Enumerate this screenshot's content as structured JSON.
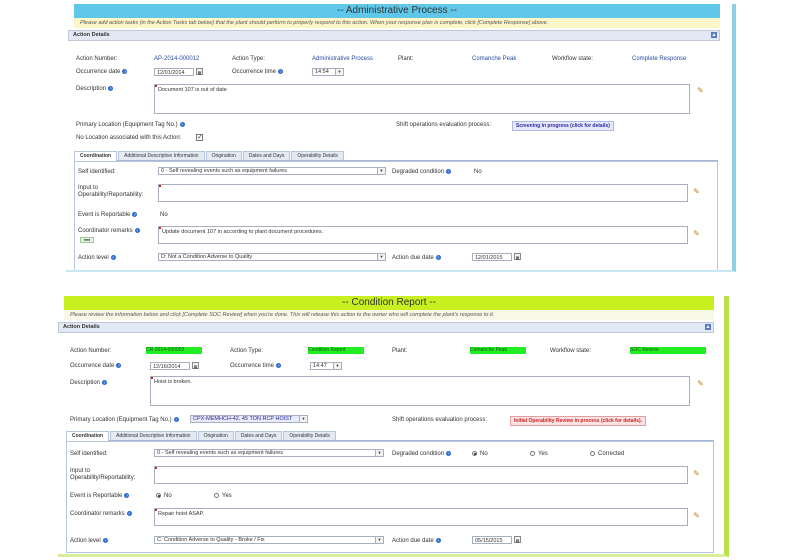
{
  "colors": {
    "panel1_title_bg": "#5fc8ea",
    "panel2_title_bg": "#c8ef20",
    "highlight_green": "#22ee22",
    "link_blue": "#2a4c9c",
    "error_red": "#d02020"
  },
  "icons": {
    "help": "help-icon",
    "calendar": "calendar-icon",
    "edit": "edit-pencil-icon",
    "dropdown": "chevron-down-icon",
    "collapse": "collapse-icon"
  },
  "admin": {
    "title": "-- Administrative Process --",
    "instruction": "Please add action tasks (in the Action Tasks tab below) that the plant should perform to properly respond to this action. When your response plan is complete, click [Complete Response] above.",
    "section": "Action Details",
    "action_number_label": "Action Number:",
    "action_number": "AP-2014-000012",
    "action_type_label": "Action Type:",
    "action_type": "Administrative Process",
    "plant_label": "Plant:",
    "plant": "Comanche Peak",
    "workflow_label": "Workflow state:",
    "workflow": "Complete Response",
    "occ_date_label": "Occurrence date",
    "occ_date": "12/01/2014",
    "occ_time_label": "Occurrence time",
    "occ_time": "14:54",
    "description_label": "Description",
    "description": "Document 107 is out of date",
    "primary_location_label": "Primary Location (Equipment Tag No.)",
    "shift_label": "Shift operations evaluation process:",
    "shift_status": "Screening in progress (click for details)",
    "no_location_label": "No Location associated with this Action:",
    "tabs": [
      "Coordination",
      "Additional Descriptive Information",
      "Origination",
      "Dates and Days",
      "Operability Details"
    ],
    "self_identified_label": "Self identified:",
    "self_identified": "0 - Self revealing events such as equipment failures",
    "degraded_label": "Degraded condition",
    "degraded": "No",
    "input_op_label": "Input to Operability/Reportability:",
    "event_reportable_label": "Event is Reportable",
    "event_reportable": "No",
    "coord_remarks_label": "Coordinator remarks",
    "coord_remarks": "Update document 107 in according to plant document procedures.",
    "action_level_label": "Action level",
    "action_level": "D: Not a Condition Adverse to Quality",
    "due_date_label": "Action due date",
    "due_date": "12/01/2015"
  },
  "condition": {
    "title": "-- Condition Report --",
    "instruction": "Please review the information below and click [Complete SOC Review] when you're done. This will release this action to the owner who will complete the plant's response to it.",
    "section": "Action Details",
    "action_number_label": "Action Number:",
    "action_number": "CR-2014-000002",
    "action_type_label": "Action Type:",
    "action_type": "Condition Report",
    "plant_label": "Plant:",
    "plant": "Comanche Peak",
    "workflow_label": "Workflow state:",
    "workflow": "SOC Review",
    "occ_date_label": "Occurrence date",
    "occ_date": "12/16/2014",
    "occ_time_label": "Occurrence time",
    "occ_time": "14:47",
    "description_label": "Description",
    "description": "Hoist is broken.",
    "primary_location_label": "Primary Location (Equipment Tag No.)",
    "primary_location": "CPX-MEMHCH-42, 45 TON RCP HOIST",
    "shift_label": "Shift operations evaluation process:",
    "shift_status": "Initial Operability Review in process (click for details).",
    "tabs": [
      "Coordination",
      "Additional Descriptive Information",
      "Origination",
      "Dates and Days",
      "Operability Details"
    ],
    "self_identified_label": "Self identified:",
    "self_identified": "0 - Self revealing events such as equipment failures",
    "degraded_label": "Degraded condition",
    "degraded_options": [
      "No",
      "Yes",
      "Corrected"
    ],
    "input_op_label": "Input to Operability/Reportability:",
    "event_reportable_label": "Event is Reportable",
    "event_reportable_options": [
      "No",
      "Yes"
    ],
    "coord_remarks_label": "Coordinator remarks",
    "coord_remarks": "Repair hoist ASAP.",
    "action_level_label": "Action level",
    "action_level": "C: Condition Adverse to Quality - Broke / Fix",
    "due_date_label": "Action due date",
    "due_date": "05/15/2015"
  }
}
